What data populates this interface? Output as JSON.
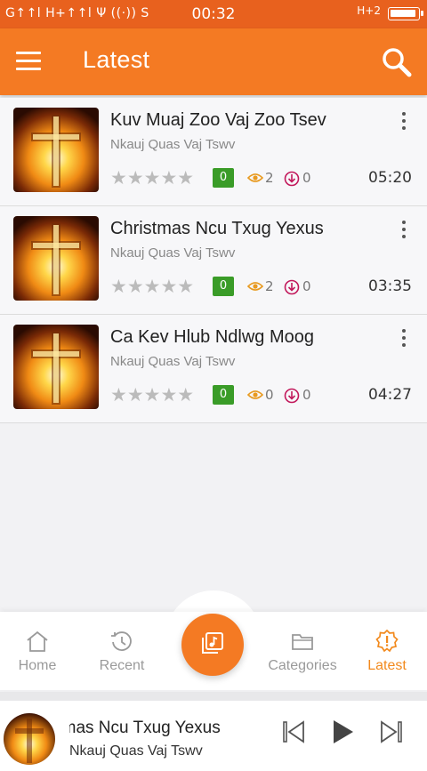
{
  "status_bar": {
    "left": "G↑↑l  H+↑↑l  Ψ  ((·))  S",
    "time": "00:32",
    "network_right": "H+2",
    "battery_level": 0.85
  },
  "app_bar": {
    "title": "Latest",
    "menu_icon": "hamburger-icon",
    "search_icon": "search-icon"
  },
  "songs": [
    {
      "title": "Kuv Muaj Zoo Vaj Zoo Tsev",
      "artist": "Nkauj Quas Vaj Tswv",
      "stars": 0,
      "rating": "0",
      "views": "2",
      "downloads": "0",
      "duration": "05:20"
    },
    {
      "title": "Christmas Ncu Txug Yexus",
      "artist": "Nkauj Quas Vaj Tswv",
      "stars": 0,
      "rating": "0",
      "views": "2",
      "downloads": "0",
      "duration": "03:35"
    },
    {
      "title": "Ca Kev Hlub Ndlwg Moog",
      "artist": "Nkauj Quas Vaj Tswv",
      "stars": 0,
      "rating": "0",
      "views": "0",
      "downloads": "0",
      "duration": "04:27"
    }
  ],
  "nav": {
    "home": "Home",
    "recent": "Recent",
    "categories": "Categories",
    "latest": "Latest",
    "active": "latest"
  },
  "player": {
    "title": "Christmas Ncu Txug Yexus",
    "artist": "Nkauj Quas Vaj Tswv"
  },
  "colors": {
    "status_bar": "#e8611e",
    "app_bar": "#f47a23",
    "accent": "#f28a1e",
    "badge": "#3a9c28"
  }
}
